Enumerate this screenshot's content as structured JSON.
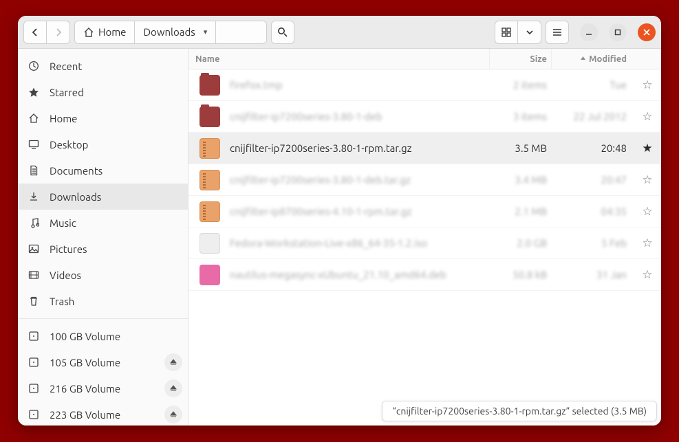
{
  "path": {
    "home": "Home",
    "current": "Downloads"
  },
  "columns": {
    "name": "Name",
    "size": "Size",
    "modified": "Modified"
  },
  "sidebar": {
    "places": [
      {
        "id": "recent",
        "label": "Recent",
        "icon": "clock"
      },
      {
        "id": "starred",
        "label": "Starred",
        "icon": "star"
      },
      {
        "id": "home",
        "label": "Home",
        "icon": "home"
      },
      {
        "id": "desktop",
        "label": "Desktop",
        "icon": "desktop"
      },
      {
        "id": "documents",
        "label": "Documents",
        "icon": "doc"
      },
      {
        "id": "downloads",
        "label": "Downloads",
        "icon": "down",
        "active": true
      },
      {
        "id": "music",
        "label": "Music",
        "icon": "music"
      },
      {
        "id": "pictures",
        "label": "Pictures",
        "icon": "pic"
      },
      {
        "id": "videos",
        "label": "Videos",
        "icon": "video"
      },
      {
        "id": "trash",
        "label": "Trash",
        "icon": "trash"
      }
    ],
    "volumes": [
      {
        "label": "100 GB Volume",
        "eject": false
      },
      {
        "label": "105 GB Volume",
        "eject": true
      },
      {
        "label": "216 GB Volume",
        "eject": true
      },
      {
        "label": "223 GB Volume",
        "eject": true
      }
    ]
  },
  "files": [
    {
      "name": "firefox.tmp",
      "size": "2 items",
      "modified": "Tue",
      "icon": "folder",
      "blur": true
    },
    {
      "name": "cnijfilter-ip7200series-3.80-1-deb",
      "size": "3 items",
      "modified": "22 Jul 2012",
      "icon": "folder",
      "blur": true
    },
    {
      "name": "cnijfilter-ip7200series-3.80-1-rpm.tar.gz",
      "size": "3.5 MB",
      "modified": "20:48",
      "icon": "arch",
      "selected": true
    },
    {
      "name": "cnijfilter-ip7200series-3.80-1-deb.tar.gz",
      "size": "3.4 MB",
      "modified": "20:47",
      "icon": "arch",
      "blur": true
    },
    {
      "name": "cnijfilter-ip8700series-4.10-1-rpm.tar.gz",
      "size": "2.1 MB",
      "modified": "04:35",
      "icon": "arch",
      "blur": true
    },
    {
      "name": "Fedora-Workstation-Live-x86_64-35-1.2.iso",
      "size": "2.0 GB",
      "modified": "5 Feb",
      "icon": "iso",
      "blur": true
    },
    {
      "name": "nautilus-megasync-xUbuntu_21.10_amd64.deb",
      "size": "50.8 kB",
      "modified": "31 Jan",
      "icon": "deb",
      "blur": true
    }
  ],
  "status": "“cnijfilter-ip7200series-3.80-1-rpm.tar.gz” selected  (3.5 MB)"
}
